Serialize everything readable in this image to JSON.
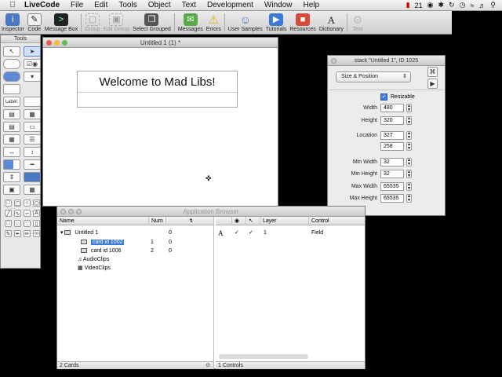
{
  "menubar": {
    "app": "LiveCode",
    "items": [
      "File",
      "Edit",
      "Tools",
      "Object",
      "Text",
      "Development",
      "Window",
      "Help"
    ],
    "status_number": "21"
  },
  "toolbar": {
    "buttons": [
      {
        "label": "Inspector",
        "icon": "inspector-icon",
        "enabled": true
      },
      {
        "label": "Code",
        "icon": "code-icon",
        "enabled": true
      },
      {
        "label": "Message Box",
        "icon": "message-box-icon",
        "enabled": true
      },
      {
        "label": "Group",
        "icon": "group-icon",
        "enabled": false
      },
      {
        "label": "Edit Group",
        "icon": "edit-group-icon",
        "enabled": false
      },
      {
        "label": "Select Grouped",
        "icon": "select-grouped-icon",
        "enabled": true
      },
      {
        "label": "Messages",
        "icon": "messages-icon",
        "enabled": true
      },
      {
        "label": "Errors",
        "icon": "errors-icon",
        "enabled": true
      },
      {
        "label": "User Samples",
        "icon": "user-samples-icon",
        "enabled": true
      },
      {
        "label": "Tutorials",
        "icon": "tutorials-icon",
        "enabled": true
      },
      {
        "label": "Resources",
        "icon": "resources-icon",
        "enabled": true
      },
      {
        "label": "Dictionary",
        "icon": "dictionary-icon",
        "enabled": true
      },
      {
        "label": "Test",
        "icon": "test-icon",
        "enabled": false
      }
    ]
  },
  "tools": {
    "title": "Tools",
    "label_tool": "Label:"
  },
  "stack_window": {
    "title": "Untitled 1 (1) *",
    "field_text": "Welcome to Mad Libs!"
  },
  "inspector": {
    "title": "stack \"Untitled 1\", ID 1025",
    "section": "Size & Position",
    "resizable_label": "Resizable",
    "properties": [
      {
        "label": "Width",
        "value": "480"
      },
      {
        "label": "Height",
        "value": "320"
      },
      {
        "label": "Location",
        "value": "327"
      },
      {
        "label": "",
        "value": "258"
      },
      {
        "label": "Min Width",
        "value": "32"
      },
      {
        "label": "Min Height",
        "value": "32"
      },
      {
        "label": "Max Width",
        "value": "65535"
      },
      {
        "label": "Max Height",
        "value": "65535"
      }
    ]
  },
  "browser": {
    "title": "Application Browser",
    "left_columns": {
      "name": "Name",
      "num": "Num"
    },
    "tree": [
      {
        "name": "Untitled 1",
        "num": "",
        "count": "0",
        "selected": false
      },
      {
        "name": "card id 1002",
        "num": "1",
        "count": "0",
        "selected": true
      },
      {
        "name": "card id 1006",
        "num": "2",
        "count": "0",
        "selected": false
      },
      {
        "name": "AudioClips",
        "num": "",
        "count": "",
        "selected": false
      },
      {
        "name": "VideoClips",
        "num": "",
        "count": "",
        "selected": false
      }
    ],
    "right_columns": {
      "layer": "Layer",
      "control": "Control"
    },
    "controls": [
      {
        "layer": "1",
        "control": "Field"
      }
    ],
    "left_status": "2 Cards",
    "right_status": "1 Controls"
  }
}
